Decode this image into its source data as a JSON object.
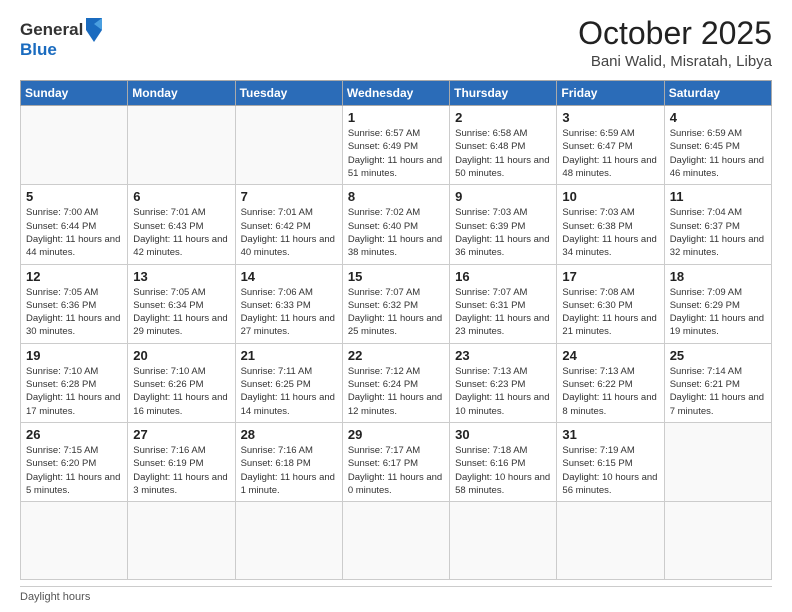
{
  "logo": {
    "line1": "General",
    "line2": "Blue"
  },
  "title": "October 2025",
  "location": "Bani Walid, Misratah, Libya",
  "weekdays": [
    "Sunday",
    "Monday",
    "Tuesday",
    "Wednesday",
    "Thursday",
    "Friday",
    "Saturday"
  ],
  "days": [
    {
      "date": null
    },
    {
      "date": null
    },
    {
      "date": null
    },
    {
      "date": 1,
      "sunrise": "6:57 AM",
      "sunset": "6:49 PM",
      "daylight": "11 hours and 51 minutes."
    },
    {
      "date": 2,
      "sunrise": "6:58 AM",
      "sunset": "6:48 PM",
      "daylight": "11 hours and 50 minutes."
    },
    {
      "date": 3,
      "sunrise": "6:59 AM",
      "sunset": "6:47 PM",
      "daylight": "11 hours and 48 minutes."
    },
    {
      "date": 4,
      "sunrise": "6:59 AM",
      "sunset": "6:45 PM",
      "daylight": "11 hours and 46 minutes."
    },
    {
      "date": 5,
      "sunrise": "7:00 AM",
      "sunset": "6:44 PM",
      "daylight": "11 hours and 44 minutes."
    },
    {
      "date": 6,
      "sunrise": "7:01 AM",
      "sunset": "6:43 PM",
      "daylight": "11 hours and 42 minutes."
    },
    {
      "date": 7,
      "sunrise": "7:01 AM",
      "sunset": "6:42 PM",
      "daylight": "11 hours and 40 minutes."
    },
    {
      "date": 8,
      "sunrise": "7:02 AM",
      "sunset": "6:40 PM",
      "daylight": "11 hours and 38 minutes."
    },
    {
      "date": 9,
      "sunrise": "7:03 AM",
      "sunset": "6:39 PM",
      "daylight": "11 hours and 36 minutes."
    },
    {
      "date": 10,
      "sunrise": "7:03 AM",
      "sunset": "6:38 PM",
      "daylight": "11 hours and 34 minutes."
    },
    {
      "date": 11,
      "sunrise": "7:04 AM",
      "sunset": "6:37 PM",
      "daylight": "11 hours and 32 minutes."
    },
    {
      "date": 12,
      "sunrise": "7:05 AM",
      "sunset": "6:36 PM",
      "daylight": "11 hours and 30 minutes."
    },
    {
      "date": 13,
      "sunrise": "7:05 AM",
      "sunset": "6:34 PM",
      "daylight": "11 hours and 29 minutes."
    },
    {
      "date": 14,
      "sunrise": "7:06 AM",
      "sunset": "6:33 PM",
      "daylight": "11 hours and 27 minutes."
    },
    {
      "date": 15,
      "sunrise": "7:07 AM",
      "sunset": "6:32 PM",
      "daylight": "11 hours and 25 minutes."
    },
    {
      "date": 16,
      "sunrise": "7:07 AM",
      "sunset": "6:31 PM",
      "daylight": "11 hours and 23 minutes."
    },
    {
      "date": 17,
      "sunrise": "7:08 AM",
      "sunset": "6:30 PM",
      "daylight": "11 hours and 21 minutes."
    },
    {
      "date": 18,
      "sunrise": "7:09 AM",
      "sunset": "6:29 PM",
      "daylight": "11 hours and 19 minutes."
    },
    {
      "date": 19,
      "sunrise": "7:10 AM",
      "sunset": "6:28 PM",
      "daylight": "11 hours and 17 minutes."
    },
    {
      "date": 20,
      "sunrise": "7:10 AM",
      "sunset": "6:26 PM",
      "daylight": "11 hours and 16 minutes."
    },
    {
      "date": 21,
      "sunrise": "7:11 AM",
      "sunset": "6:25 PM",
      "daylight": "11 hours and 14 minutes."
    },
    {
      "date": 22,
      "sunrise": "7:12 AM",
      "sunset": "6:24 PM",
      "daylight": "11 hours and 12 minutes."
    },
    {
      "date": 23,
      "sunrise": "7:13 AM",
      "sunset": "6:23 PM",
      "daylight": "11 hours and 10 minutes."
    },
    {
      "date": 24,
      "sunrise": "7:13 AM",
      "sunset": "6:22 PM",
      "daylight": "11 hours and 8 minutes."
    },
    {
      "date": 25,
      "sunrise": "7:14 AM",
      "sunset": "6:21 PM",
      "daylight": "11 hours and 7 minutes."
    },
    {
      "date": 26,
      "sunrise": "7:15 AM",
      "sunset": "6:20 PM",
      "daylight": "11 hours and 5 minutes."
    },
    {
      "date": 27,
      "sunrise": "7:16 AM",
      "sunset": "6:19 PM",
      "daylight": "11 hours and 3 minutes."
    },
    {
      "date": 28,
      "sunrise": "7:16 AM",
      "sunset": "6:18 PM",
      "daylight": "11 hours and 1 minute."
    },
    {
      "date": 29,
      "sunrise": "7:17 AM",
      "sunset": "6:17 PM",
      "daylight": "11 hours and 0 minutes."
    },
    {
      "date": 30,
      "sunrise": "7:18 AM",
      "sunset": "6:16 PM",
      "daylight": "10 hours and 58 minutes."
    },
    {
      "date": 31,
      "sunrise": "7:19 AM",
      "sunset": "6:15 PM",
      "daylight": "10 hours and 56 minutes."
    },
    {
      "date": null
    },
    {
      "date": null
    },
    {
      "date": null
    },
    {
      "date": null
    }
  ],
  "footer": "Daylight hours"
}
